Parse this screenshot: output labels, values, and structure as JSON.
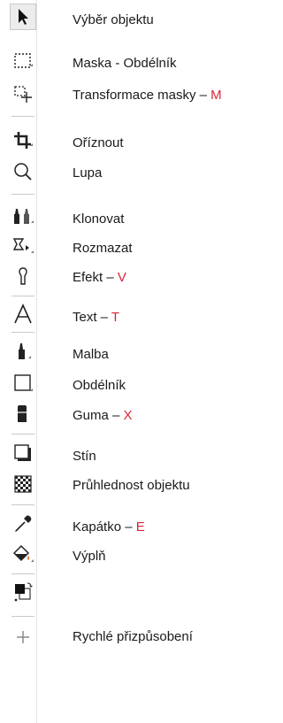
{
  "tools": [
    {
      "name": "Výběr objektu",
      "shortcut": ""
    },
    {
      "name": "Maska - Obdélník",
      "shortcut": ""
    },
    {
      "name": "Transformace masky",
      "sep": " – ",
      "shortcut": "M"
    },
    {
      "name": "Oříznout",
      "shortcut": ""
    },
    {
      "name": "Lupa",
      "shortcut": ""
    },
    {
      "name": "Klonovat",
      "shortcut": ""
    },
    {
      "name": "Rozmazat",
      "shortcut": ""
    },
    {
      "name": "Efekt",
      "sep": " – ",
      "shortcut": "V"
    },
    {
      "name": "Text",
      "sep": " – ",
      "shortcut": "T"
    },
    {
      "name": "Malba",
      "shortcut": ""
    },
    {
      "name": "Obdélník",
      "shortcut": ""
    },
    {
      "name": "Guma",
      "sep": " – ",
      "shortcut": "X"
    },
    {
      "name": "Stín",
      "shortcut": ""
    },
    {
      "name": "Průhlednost objektu",
      "shortcut": ""
    },
    {
      "name": "Kapátko",
      "sep": " – ",
      "shortcut": "E"
    },
    {
      "name": "Výplň",
      "shortcut": ""
    },
    {
      "name": "Rychlé přizpůsobení",
      "shortcut": ""
    }
  ],
  "colors": {
    "accent": "#d9263a"
  }
}
